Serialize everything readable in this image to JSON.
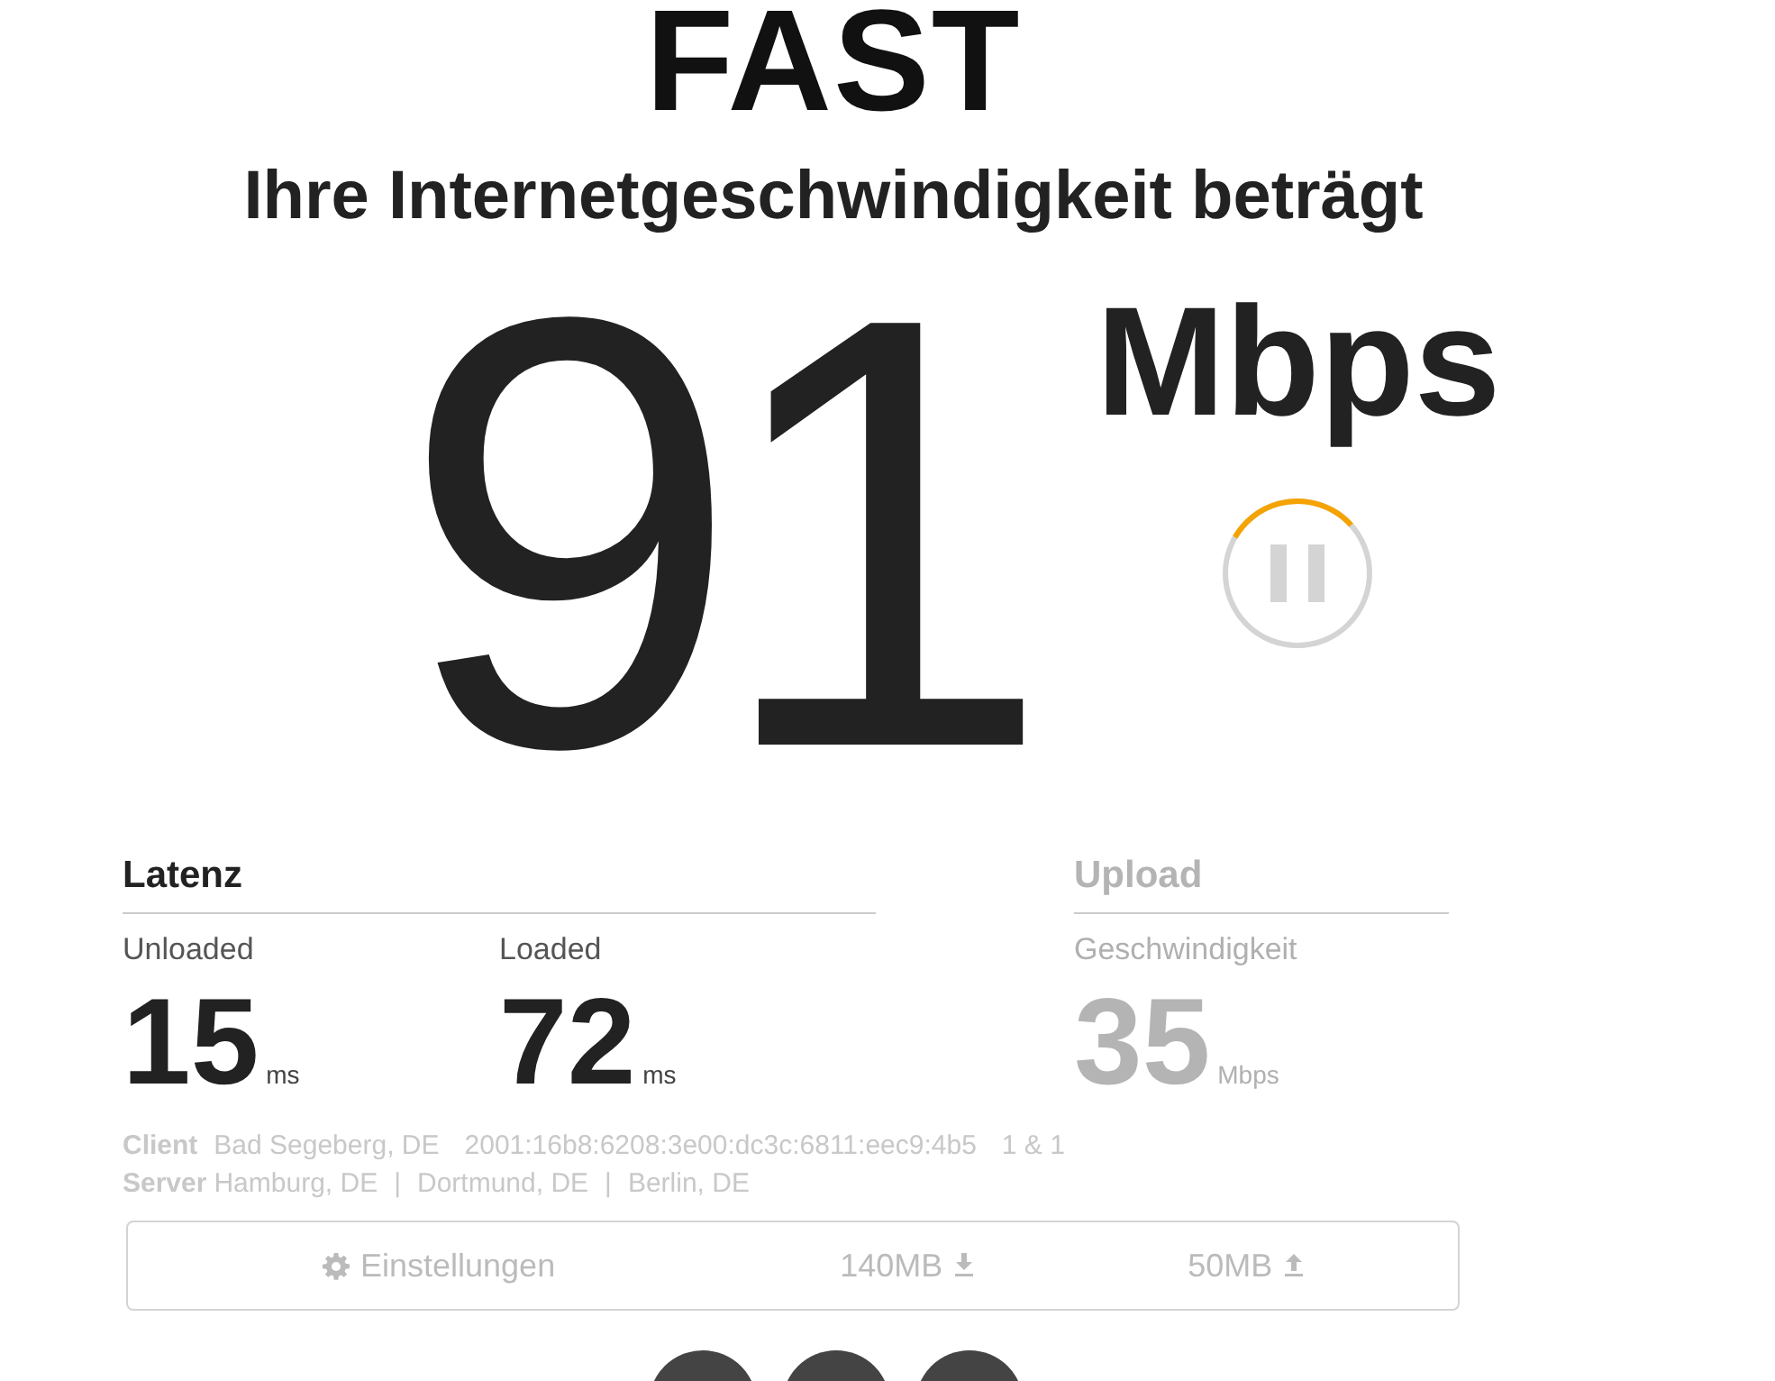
{
  "logo": "FAST",
  "heading": "Ihre Internetgeschwindigkeit beträgt",
  "speed": {
    "value": "91",
    "unit": "Mbps"
  },
  "pause_button": {
    "level": 0.3
  },
  "sections": [
    {
      "title": "Latenz",
      "dimmed": false,
      "metrics": [
        {
          "label": "Unloaded",
          "value": "15",
          "unit": "ms"
        },
        {
          "label": "Loaded",
          "value": "72",
          "unit": "ms"
        }
      ]
    },
    {
      "title": "Upload",
      "dimmed": true,
      "metrics": [
        {
          "label": "Geschwindigkeit",
          "value": "35",
          "unit": "Mbps"
        }
      ]
    }
  ],
  "client": {
    "label": "Client",
    "location": "Bad Segeberg, DE",
    "ip": "2001:16b8:6208:3e00:dc3c:6811:eec9:4b5",
    "isp": "1 & 1"
  },
  "server": {
    "label": "Server",
    "locations": [
      "Hamburg, DE",
      "Dortmund, DE",
      "Berlin, DE"
    ],
    "separator": "|"
  },
  "settings_bar": {
    "settings": "Einstellungen",
    "download": "140MB",
    "upload": "50MB"
  },
  "bottom_buttons": [
    {
      "kind": "circle"
    },
    {
      "kind": "circle"
    },
    {
      "kind": "circle"
    }
  ]
}
